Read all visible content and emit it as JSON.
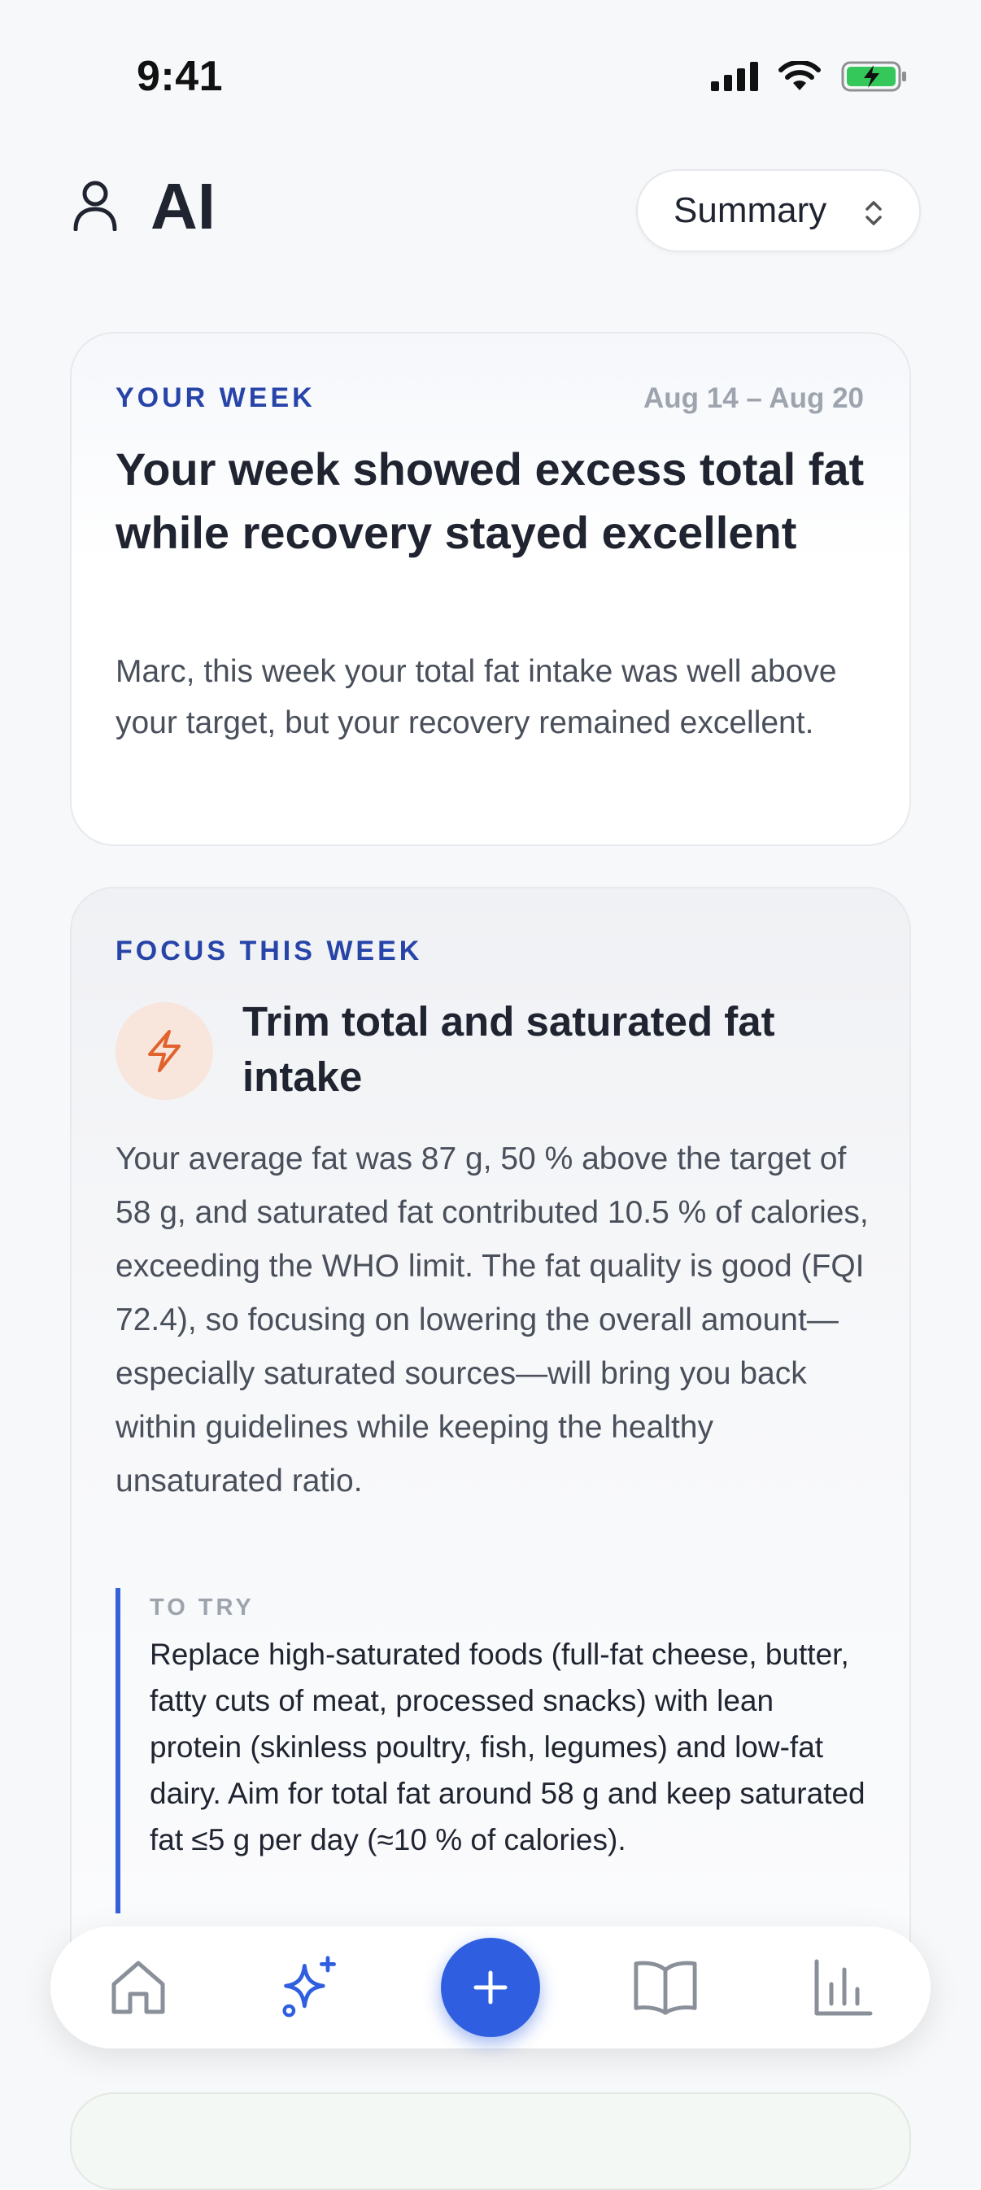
{
  "status_bar": {
    "time": "9:41"
  },
  "header": {
    "title": "AI",
    "view_select": {
      "selected": "Summary"
    }
  },
  "week_card": {
    "eyebrow": "YOUR WEEK",
    "date_range": "Aug 14 – Aug 20",
    "title": "Your week showed excess total fat while recovery stayed excellent",
    "body": "Marc, this week your total fat intake was well above your target, but your recovery remained excellent."
  },
  "focus_card": {
    "eyebrow": "FOCUS THIS WEEK",
    "icon": "bolt-icon",
    "title": "Trim total and saturated fat intake",
    "body": "Your average fat was 87 g, 50 % above the target of 58 g, and saturated fat contributed 10.5 % of calories, exceeding the WHO limit. The fat quality is good (FQI 72.4), so focusing on lowering the overall amount—especially saturated sources—will bring you back within guidelines while keeping the healthy unsaturated ratio.",
    "to_try": {
      "label": "TO TRY",
      "text": "Replace high-saturated foods (full-fat cheese, butter, fatty cuts of meat, processed snacks) with lean protein (skinless poultry, fish, legumes) and low-fat dairy. Aim for total fat around 58 g and keep saturated fat ≤5 g per day (≈10 % of calories)."
    }
  },
  "tab_bar": {
    "items": [
      "home-icon",
      "sparkles-icon",
      "plus-icon",
      "book-icon",
      "bar-chart-icon"
    ],
    "active": "sparkles-icon"
  },
  "colors": {
    "accent": "#2f5fe0",
    "eyebrow": "#2744a8",
    "bolt": "#e0622d",
    "bolt_bg": "#f8e5dc",
    "battery": "#34c759"
  }
}
